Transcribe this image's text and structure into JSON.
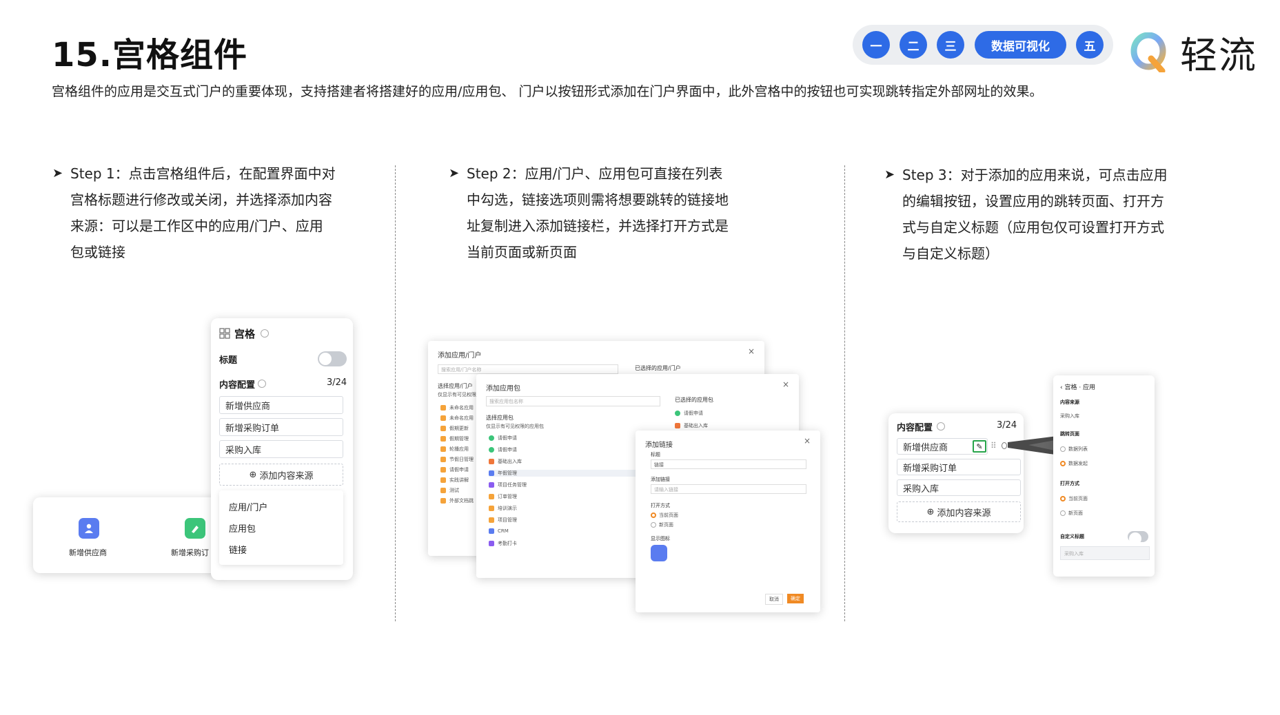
{
  "header": {
    "title": "15.宫格组件",
    "description": "宫格组件的应用是交互式门户的重要体现，支持搭建者将搭建好的应用/应用包、 门户以按钮形式添加在门户界面中，此外宫格中的按钮也可实现跳转指定外部网址的效果。",
    "nav": [
      "一",
      "二",
      "三",
      "数据可视化",
      "五"
    ],
    "logo_text": "轻流",
    "accent_color": "#2e6be6"
  },
  "steps": [
    {
      "label": "Step 1",
      "lines": [
        "Step 1：点击宫格组件后，在配置界面中对",
        "宫格标题进行修改或关闭，并选择添加内容",
        "来源：可以是工作区中的应用/门户、应用",
        "包或链接"
      ]
    },
    {
      "label": "Step 2",
      "lines": [
        "Step 2：应用/门户、应用包可直接在列表",
        "中勾选，链接选项则需将想要跳转的链接地",
        "址复制进入添加链接栏，并选择打开方式是",
        "当前页面或新页面"
      ]
    },
    {
      "label": "Step 3",
      "lines": [
        "Step 3：对于添加的应用来说，可点击应用",
        "的编辑按钮，设置应用的跳转页面、打开方",
        "式与自定义标题（应用包仅可设置打开方式",
        "与自定义标题）"
      ]
    }
  ],
  "panel1": {
    "title": "宫格",
    "title_label": "标题",
    "content_label": "内容配置",
    "count": "3/24",
    "items": [
      "新增供应商",
      "新增采购订单",
      "采购入库"
    ],
    "add_source": "添加内容来源",
    "menu": [
      "应用/门户",
      "应用包",
      "链接"
    ],
    "preview": [
      "新增供应商",
      "新增采购订"
    ]
  },
  "panel2": {
    "dialog1": {
      "title": "添加应用/门户",
      "search_placeholder": "搜索应用/门户名称",
      "selected_title": "已选择的应用/门户",
      "section": "选择应用/门户",
      "hint": "仅显示有可见权限的",
      "items": [
        "未命名应用",
        "未命名应用",
        "假期更新",
        "假期管理",
        "轮播应用",
        "节假日管理",
        "请假申请",
        "实践讲解",
        "测试",
        "外部文档跳"
      ]
    },
    "dialog2": {
      "title": "添加应用包",
      "search_placeholder": "搜索应用包名称",
      "section": "选择应用包",
      "hint": "仅显示有可见权限的应用包",
      "selected_title": "已选择的应用包",
      "selected": [
        "请假申请",
        "基础出入库"
      ],
      "items": [
        "请假申请",
        "请假申请",
        "基础出入库",
        "年假管理",
        "项目任务管理",
        "订单管理",
        "培训演示",
        "项目管理",
        "CRM",
        "考勤打卡"
      ]
    },
    "dialog3": {
      "title": "添加链接",
      "label_title": "标题",
      "title_value": "链接",
      "label_link": "添加链接",
      "link_placeholder": "请输入链接",
      "label_open": "打开方式",
      "open_options": [
        "当前页面",
        "新页面"
      ],
      "label_icon": "显示图标",
      "cancel": "取消",
      "confirm": "确定"
    }
  },
  "panel3": {
    "content_label": "内容配置",
    "count": "3/24",
    "items": [
      "新增供应商",
      "新增采购订单",
      "采购入库"
    ],
    "add_source": "添加内容来源",
    "side": {
      "breadcrumb": "宫格 · 应用",
      "source_label": "内容来源",
      "source_value": "采购入库",
      "jump_label": "跳转页面",
      "jump_options": [
        "数据列表",
        "数据发起"
      ],
      "open_label": "打开方式",
      "open_options": [
        "当前页面",
        "新页面"
      ],
      "custom_title_label": "自定义标题",
      "custom_title_value": "采购入库"
    }
  }
}
